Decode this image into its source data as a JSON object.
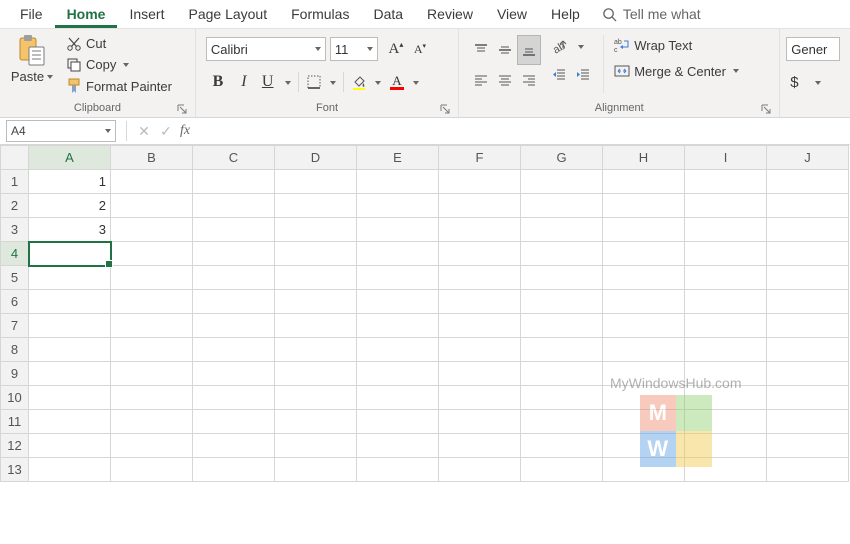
{
  "menu": {
    "tabs": [
      "File",
      "Home",
      "Insert",
      "Page Layout",
      "Formulas",
      "Data",
      "Review",
      "View",
      "Help"
    ],
    "active_index": 1,
    "tellme": "Tell me what"
  },
  "ribbon": {
    "clipboard": {
      "paste": "Paste",
      "cut": "Cut",
      "copy": "Copy",
      "format_painter": "Format Painter",
      "label": "Clipboard"
    },
    "font": {
      "name": "Calibri",
      "size": "11",
      "grow": "A",
      "shrink": "A",
      "bold": "B",
      "italic": "I",
      "underline": "U",
      "fill_color_glyph": "",
      "font_color_glyph": "A",
      "label": "Font"
    },
    "alignment": {
      "wrap": "Wrap Text",
      "merge": "Merge & Center",
      "label": "Alignment"
    },
    "number": {
      "format": "Gener",
      "currency": "$"
    }
  },
  "fx": {
    "namebox": "A4",
    "fx_label": "fx",
    "formula": ""
  },
  "grid": {
    "cols": [
      "A",
      "B",
      "C",
      "D",
      "E",
      "F",
      "G",
      "H",
      "I",
      "J"
    ],
    "rows": [
      1,
      2,
      3,
      4,
      5,
      6,
      7,
      8,
      9,
      10,
      11,
      12,
      13
    ],
    "cells": {
      "A1": "1",
      "A2": "2",
      "A3": "3"
    },
    "selected": "A4"
  },
  "watermark": {
    "text": "MyWindowsHub.com",
    "letters": [
      "M",
      "W"
    ]
  }
}
